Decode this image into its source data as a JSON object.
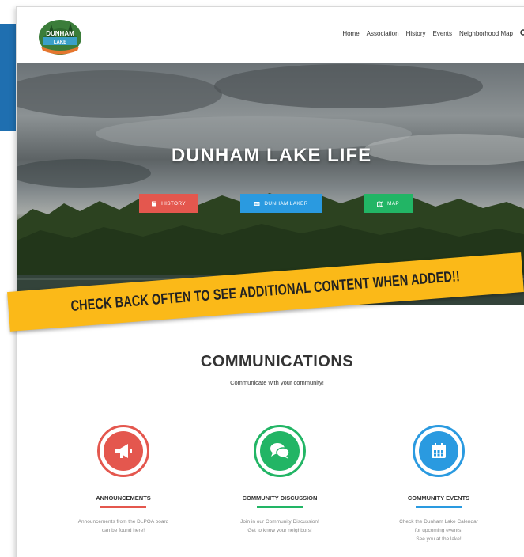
{
  "nav": {
    "items": [
      "Home",
      "Association",
      "History",
      "Events",
      "Neighborhood Map"
    ],
    "search_icon": "search-icon"
  },
  "logo": {
    "text_line1": "DUNHAM",
    "text_line2": "LAKE"
  },
  "hero": {
    "title": "DUNHAM LAKE LIFE",
    "buttons": [
      {
        "label": "HISTORY",
        "icon": "book-icon",
        "color": "#e4574e"
      },
      {
        "label": "DUNHAM LAKER",
        "icon": "newspaper-icon",
        "color": "#2a9ae0"
      },
      {
        "label": "MAP",
        "icon": "map-icon",
        "color": "#22b565"
      }
    ]
  },
  "banner": {
    "text": "CHECK BACK OFTEN TO SEE ADDITIONAL CONTENT WHEN ADDED!!",
    "color": "#fbb918"
  },
  "communications": {
    "title": "COMMUNICATIONS",
    "subtitle": "Communicate with your community!",
    "columns": [
      {
        "title": "ANNOUNCEMENTS",
        "desc_line1": "Announcements from the DLPOA board",
        "desc_line2": "can be found here!",
        "desc_line3": "",
        "icon": "megaphone-icon",
        "color": "#e4574e"
      },
      {
        "title": "COMMUNITY DISCUSSION",
        "desc_line1": "Join in our Community Discussion!",
        "desc_line2": "Get to know your neighbors!",
        "desc_line3": "",
        "icon": "chat-icon",
        "color": "#22b565"
      },
      {
        "title": "COMMUNITY EVENTS",
        "desc_line1": "Check the Dunham Lake Calendar",
        "desc_line2": "for upcoming events!",
        "desc_line3": "See you at the lake!",
        "icon": "calendar-icon",
        "color": "#2a9ae0"
      }
    ]
  }
}
